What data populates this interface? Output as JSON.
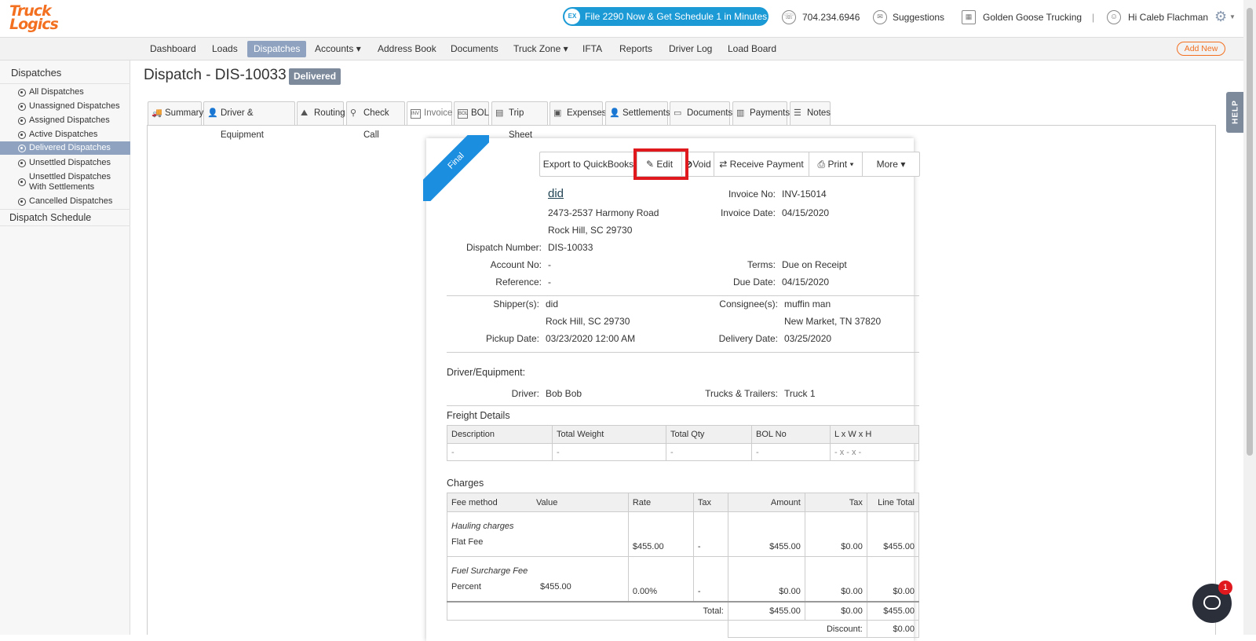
{
  "header": {
    "logo_line1": "Truck",
    "logo_line2": "Logics",
    "promo": "File 2290 Now & Get Schedule 1 in Minutes",
    "promo_icon": "EX",
    "phone": "704.234.6946",
    "suggestions": "Suggestions",
    "company": "Golden Goose Trucking",
    "separator": "|",
    "greeting": "Hi Caleb Flachman"
  },
  "nav": {
    "items": [
      "Dashboard",
      "Loads",
      "Dispatches",
      "Accounts ▾",
      "Address Book",
      "Documents",
      "Truck Zone ▾",
      "IFTA",
      "Reports",
      "Driver Log",
      "Load Board"
    ],
    "add_new": "Add New"
  },
  "sidebar": {
    "title": "Dispatches",
    "items": [
      "All Dispatches",
      "Unassigned Dispatches",
      "Assigned Dispatches",
      "Active Dispatches",
      "Delivered Dispatches",
      "Unsettled Dispatches",
      "Unsettled Dispatches",
      "With Settlements",
      "Cancelled Dispatches"
    ],
    "schedule": "Dispatch Schedule"
  },
  "page": {
    "title": "Dispatch - DIS-10033",
    "status": "Delivered"
  },
  "tabs": [
    "Summary",
    "Driver & Equipment",
    "Routing",
    "Check Call",
    "Invoice",
    "BOL",
    "Trip Sheet",
    "Expenses",
    "Settlements",
    "Documents",
    "Payments",
    "Notes"
  ],
  "invoice": {
    "ribbon": "Final",
    "buttons": {
      "export": "Export to QuickBooks",
      "edit": "Edit",
      "void": "Void",
      "receive": "Receive Payment",
      "print": "Print ▾",
      "more": "More ▾"
    },
    "company_name": "did",
    "address1": "2473-2537 Harmony Road",
    "address2": "Rock Hill, SC 29730",
    "labels": {
      "invoice_no": "Invoice No:",
      "invoice_date": "Invoice Date:",
      "dispatch_number": "Dispatch Number:",
      "account_no": "Account No:",
      "reference": "Reference:",
      "terms": "Terms:",
      "due_date": "Due Date:",
      "shippers": "Shipper(s):",
      "consignees": "Consignee(s):",
      "pickup_date": "Pickup Date:",
      "delivery_date": "Delivery Date:",
      "driver": "Driver:",
      "trucks_trailers": "Trucks & Trailers:"
    },
    "invoice_no": "INV-15014",
    "invoice_date": "04/15/2020",
    "dispatch_number": "DIS-10033",
    "account_no": "-",
    "reference": "-",
    "terms": "Due on Receipt",
    "due_date": "04/15/2020",
    "shipper_name": "did",
    "shipper_city": "Rock Hill, SC 29730",
    "pickup_date": "03/23/2020 12:00 AM",
    "consignee_name": "muffin man",
    "consignee_city": "New Market, TN 37820",
    "delivery_date": "03/25/2020",
    "driver_equipment_title": "Driver/Equipment:",
    "driver": "Bob Bob",
    "trucks": "Truck 1",
    "freight_title": "Freight Details",
    "freight_headers": [
      "Description",
      "Total Weight",
      "Total Qty",
      "BOL No",
      "L x W x H"
    ],
    "freight_row": [
      "-",
      "-",
      "-",
      "-",
      "- x - x -"
    ],
    "charges_title": "Charges",
    "charges_headers": [
      "Fee method",
      "Value",
      "Rate",
      "Tax",
      "Amount",
      "Tax",
      "Line Total"
    ],
    "hauling_title": "Hauling charges",
    "hauling_row": [
      "Flat Fee",
      "",
      "$455.00",
      "-",
      "$455.00",
      "$0.00",
      "$455.00"
    ],
    "fuel_title": "Fuel Surcharge Fee",
    "fuel_row": [
      "Percent",
      "$455.00",
      "0.00%",
      "-",
      "$0.00",
      "$0.00",
      "$0.00"
    ],
    "total_label": "Total:",
    "total_amount": "$455.00",
    "total_tax": "$0.00",
    "total_line": "$455.00",
    "discount_label": "Discount:",
    "discount_value": "$0.00"
  },
  "help": "HELP",
  "chat_badge": "1"
}
